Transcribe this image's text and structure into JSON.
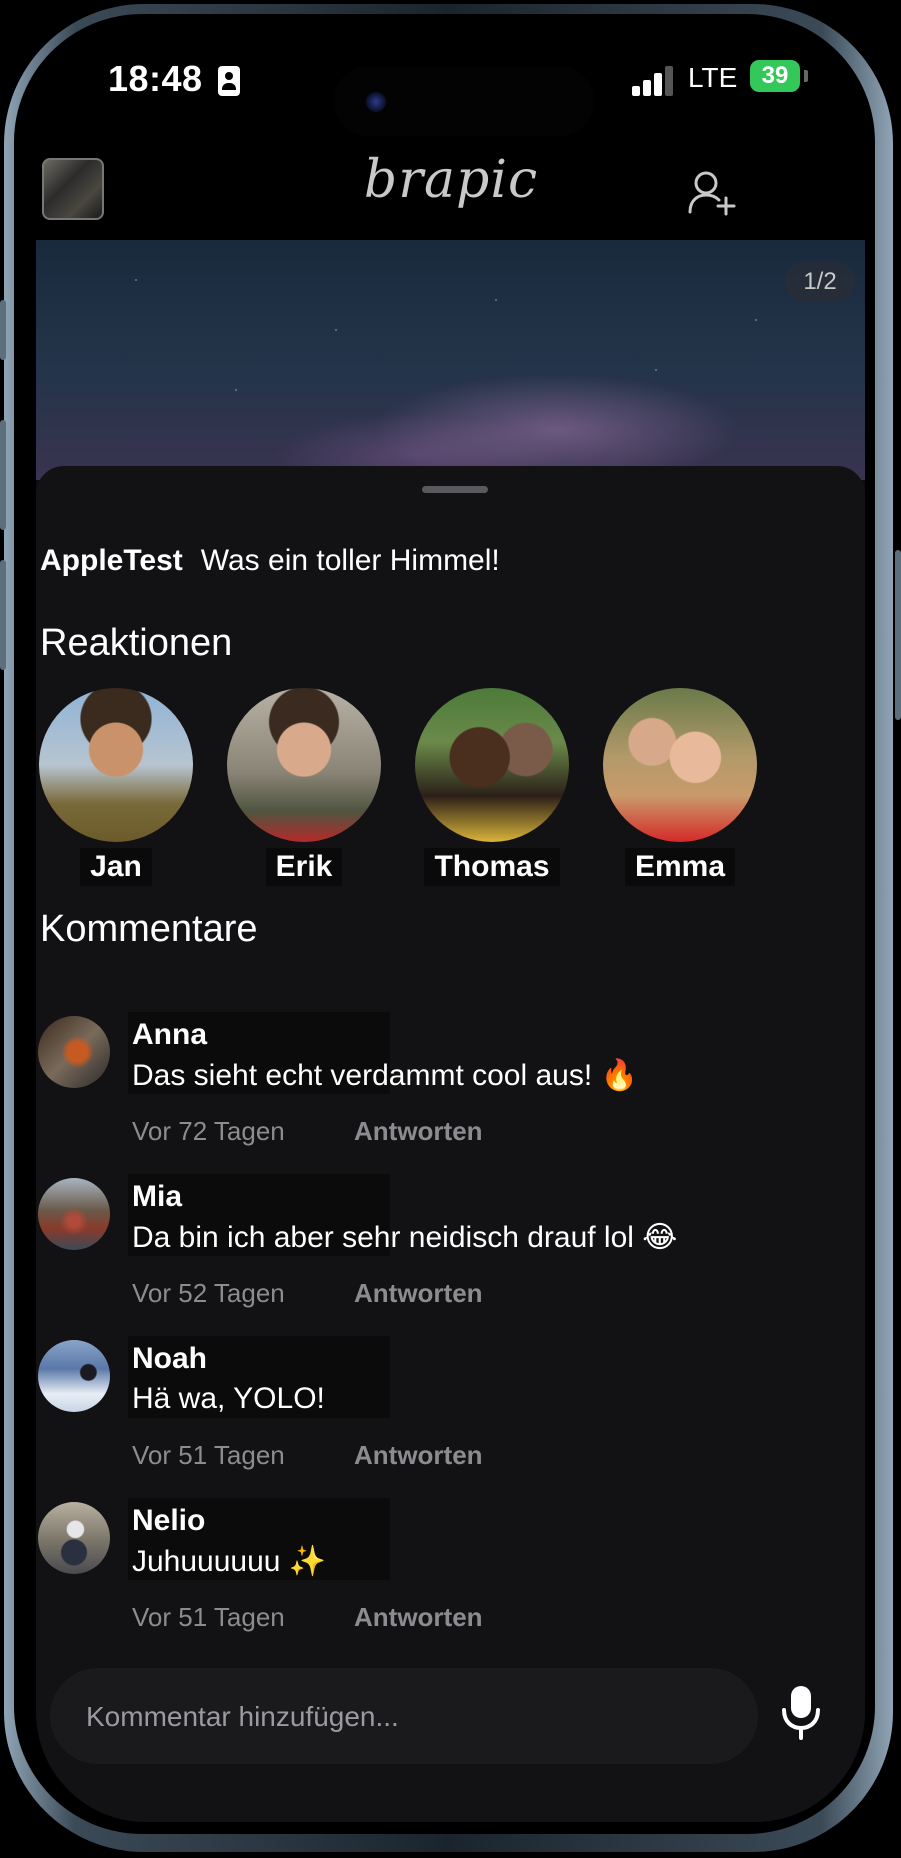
{
  "status_bar": {
    "time": "18:48",
    "network": "LTE",
    "battery": "39"
  },
  "header": {
    "logo": "brapic"
  },
  "hero": {
    "page_indicator": "1/2"
  },
  "post": {
    "author": "AppleTest",
    "caption": "Was ein toller Himmel!"
  },
  "reactions": {
    "title": "Reaktionen",
    "people": [
      {
        "name": "Jan"
      },
      {
        "name": "Erik"
      },
      {
        "name": "Thomas"
      },
      {
        "name": "Emma"
      }
    ]
  },
  "comments": {
    "title": "Kommentare",
    "items": [
      {
        "name": "Anna",
        "text": "Das sieht echt verdammt cool aus! 🔥",
        "time": "Vor 72 Tagen",
        "reply": "Antworten"
      },
      {
        "name": "Mia",
        "text": "Da bin ich aber sehr neidisch drauf lol 😂",
        "time": "Vor 52 Tagen",
        "reply": "Antworten"
      },
      {
        "name": "Noah",
        "text": "Hä wa, YOLO!",
        "time": "Vor 51 Tagen",
        "reply": "Antworten"
      },
      {
        "name": "Nelio",
        "text": "Juhuuuuuu ✨",
        "time": "Vor 51 Tagen",
        "reply": "Antworten"
      }
    ]
  },
  "composer": {
    "placeholder": "Kommentar hinzufügen..."
  }
}
